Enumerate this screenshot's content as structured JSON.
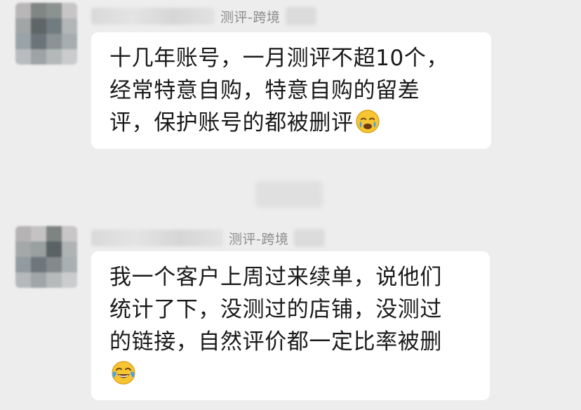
{
  "messages": [
    {
      "group_tag": "测评-跨境",
      "lines": [
        "十几年账号，一月测评不超10个，",
        "经常特意自购，特意自购的留差",
        "评，保护账号的都被删评"
      ],
      "trailing_emoji": "crying-face-icon"
    },
    {
      "group_tag": "测评-跨境",
      "lines": [
        "我一个客户上周过来续单，说他们",
        "统计了下，没测过的店铺，没测过",
        "的链接，自然评价都一定比率被删",
        ""
      ],
      "trailing_emoji": "tears-of-joy-icon"
    }
  ],
  "colors": {
    "background": "#ededed",
    "bubble": "#ffffff",
    "text": "#1a1a1a",
    "group_tag": "#8c8c8c"
  }
}
